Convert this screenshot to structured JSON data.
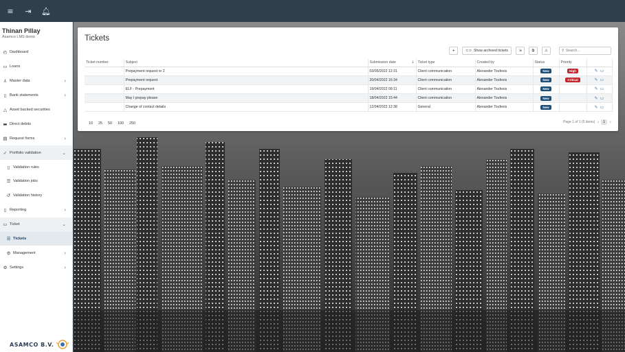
{
  "topbar": {
    "menu_icon": "menu-icon",
    "logout_icon": "logout-icon",
    "bell_icon": "bell-icon"
  },
  "user": {
    "name": "Thinan Pillay",
    "org": "Asamco LMS demo"
  },
  "nav": {
    "dashboard": "Dashboard",
    "loans": "Loans",
    "master_data": "Master data",
    "bank_statements": "Bank statements",
    "abs": "Asset backed securities",
    "direct_debits": "Direct debits",
    "request_forms": "Request forms",
    "portfolio_validation": "Portfolio validation",
    "validation_rules": "Validation rules",
    "validation_jobs": "Validation jobs",
    "validation_history": "Validation history",
    "reporting": "Reporting",
    "ticket": "Ticket",
    "tickets": "Tickets",
    "management": "Management",
    "settings": "Settings"
  },
  "brand": {
    "text": "ASAMCO B.V."
  },
  "card": {
    "title": "Tickets",
    "add_label": "+",
    "archived_label": "Show archived tickets",
    "search_placeholder": "Search..."
  },
  "columns": {
    "ticket_number": "Ticket number",
    "subject": "Subject",
    "submission_date": "Submission date",
    "ticket_type": "Ticket type",
    "created_by": "Created by",
    "status": "Status",
    "priority": "Priority"
  },
  "rows": [
    {
      "ticket_number": "",
      "subject": "Prepayment request nr 2",
      "date": "03/05/2022 12:31",
      "type": "Client communication",
      "created_by": "Alexander Toufexis",
      "status": "New",
      "priority": "High"
    },
    {
      "ticket_number": "",
      "subject": "Prepayment request",
      "date": "20/04/2022 16:34",
      "type": "Client communication",
      "created_by": "Alexander Toufexis",
      "status": "New",
      "priority": "Critical"
    },
    {
      "ticket_number": "",
      "subject": "ELF - Prepayment",
      "date": "19/04/2022 09:11",
      "type": "Client communication",
      "created_by": "Alexander Toufexis",
      "status": "New",
      "priority": ""
    },
    {
      "ticket_number": "",
      "subject": "May I prepay please",
      "date": "18/04/2022 15:44",
      "type": "Client communication",
      "created_by": "Alexander Toufexis",
      "status": "New",
      "priority": ""
    },
    {
      "ticket_number": "",
      "subject": "Change of contact details",
      "date": "12/04/2022 12:38",
      "type": "General",
      "created_by": "Alexander Toufexis",
      "status": "New",
      "priority": ""
    }
  ],
  "pager": {
    "sizes": [
      "10",
      "25",
      "50",
      "100",
      "250"
    ],
    "info": "Page 1 of 1 (5 items)",
    "current": "1"
  },
  "colors": {
    "topbar": "#2f3f4b",
    "status_badge": "#1e4f7a",
    "priority_badge": "#c0262d",
    "active_nav": "#1a3c63"
  }
}
